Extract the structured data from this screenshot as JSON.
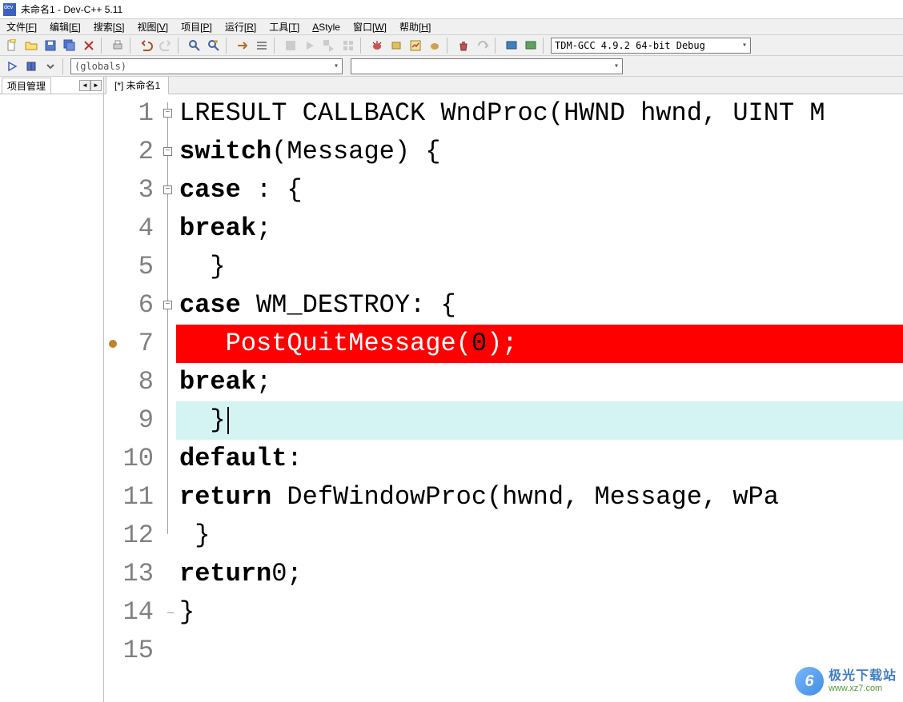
{
  "window": {
    "title": "未命名1 - Dev-C++ 5.11"
  },
  "menubar": {
    "items": [
      {
        "label": "文件",
        "key": "F"
      },
      {
        "label": "编辑",
        "key": "E"
      },
      {
        "label": "搜索",
        "key": "S"
      },
      {
        "label": "视图",
        "key": "V"
      },
      {
        "label": "项目",
        "key": "P"
      },
      {
        "label": "运行",
        "key": "R"
      },
      {
        "label": "工具",
        "key": "T"
      },
      {
        "label": "AStyle",
        "key": ""
      },
      {
        "label": "窗口",
        "key": "W"
      },
      {
        "label": "帮助",
        "key": "H"
      }
    ]
  },
  "toolbar1": {
    "compiler": "TDM-GCC 4.9.2 64-bit Debug"
  },
  "toolbar2": {
    "globals": "(globals)"
  },
  "sidebar": {
    "tab": "项目管理"
  },
  "editor": {
    "tab": "[*] 未命名1",
    "breakpoint_line": 7,
    "current_line": 9,
    "lines": [
      {
        "n": 1,
        "fold": "minus",
        "html": "LRESULT CALLBACK WndProc(HWND hwnd, UINT M"
      },
      {
        "n": 2,
        "fold": "minus",
        "html": " <span class='kw'>switch</span>(Message) {"
      },
      {
        "n": 3,
        "fold": "minus",
        "html": "  <span class='kw'>case</span> : {"
      },
      {
        "n": 4,
        "fold": "",
        "html": "   <span class='kw'>break</span>;"
      },
      {
        "n": 5,
        "fold": "",
        "html": "  }"
      },
      {
        "n": 6,
        "fold": "minus",
        "html": "  <span class='kw'>case</span> WM_DESTROY: {"
      },
      {
        "n": 7,
        "fold": "",
        "html": "   PostQuitMessage(<span class='num'>0</span>);"
      },
      {
        "n": 8,
        "fold": "",
        "html": "   <span class='kw'>break</span>;"
      },
      {
        "n": 9,
        "fold": "",
        "html": "  }"
      },
      {
        "n": 10,
        "fold": "",
        "html": "  <span class='kw'>default</span>:"
      },
      {
        "n": 11,
        "fold": "",
        "html": "   <span class='kw'>return</span> DefWindowProc(hwnd, Message, wPa"
      },
      {
        "n": 12,
        "fold": "",
        "html": " }"
      },
      {
        "n": 13,
        "fold": "",
        "html": " <span class='kw'>return</span> <span class='num'>0</span>;"
      },
      {
        "n": 14,
        "fold": "end",
        "html": "}"
      },
      {
        "n": 15,
        "fold": "",
        "html": ""
      }
    ]
  },
  "watermark": {
    "title": "极光下载站",
    "url": "www.xz7.com",
    "logo": "6"
  }
}
